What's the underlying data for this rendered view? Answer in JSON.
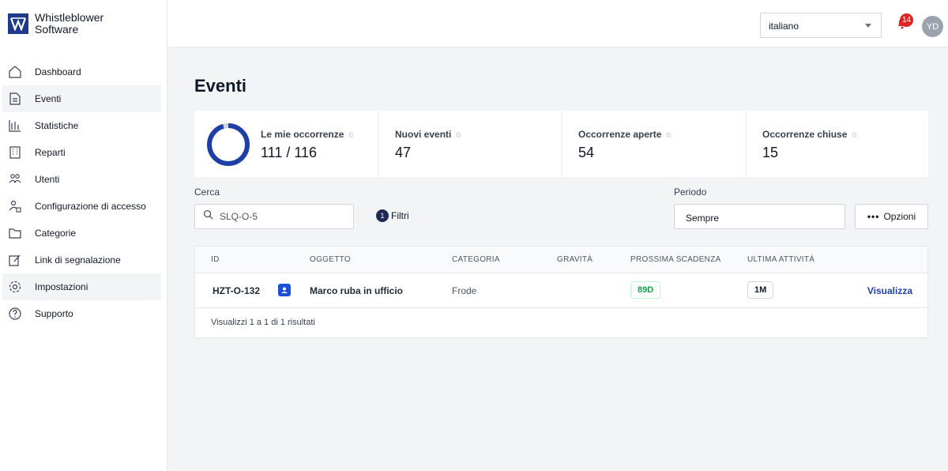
{
  "app": {
    "name_line1": "Whistleblower",
    "name_line2": "Software"
  },
  "sidebar": {
    "items": [
      {
        "label": "Dashboard",
        "icon": "home-icon"
      },
      {
        "label": "Eventi",
        "icon": "document-icon",
        "active": true
      },
      {
        "label": "Statistiche",
        "icon": "chart-icon"
      },
      {
        "label": "Reparti",
        "icon": "building-icon"
      },
      {
        "label": "Utenti",
        "icon": "users-icon"
      },
      {
        "label": "Configurazione di accesso",
        "icon": "user-lock-icon"
      },
      {
        "label": "Categorie",
        "icon": "folder-icon"
      },
      {
        "label": "Link di segnalazione",
        "icon": "edit-link-icon"
      },
      {
        "label": "Impostazioni",
        "icon": "gear-icon",
        "active": true
      },
      {
        "label": "Supporto",
        "icon": "help-icon"
      }
    ]
  },
  "header": {
    "language": "italiano",
    "notification_count": "14",
    "avatar_initials": "YD"
  },
  "page": {
    "title": "Eventi"
  },
  "stats": {
    "mine_label": "Le mie occorrenze",
    "mine_value": "111 / 116",
    "mine_ratio": 0.957,
    "new_label": "Nuovi eventi",
    "new_value": "47",
    "open_label": "Occorrenze aperte",
    "open_value": "54",
    "closed_label": "Occorrenze chiuse",
    "closed_value": "15"
  },
  "search": {
    "label": "Cerca",
    "value": "SLQ-O-5"
  },
  "filters": {
    "count": "1",
    "label": "Filtri"
  },
  "period": {
    "label": "Periodo",
    "value": "Sempre"
  },
  "options": {
    "label": "Opzioni"
  },
  "table": {
    "columns": [
      "ID",
      "OGGETTO",
      "CATEGORIA",
      "GRAVITÀ",
      "PROSSIMA SCADENZA",
      "ULTIMA ATTIVITÀ"
    ],
    "rows": [
      {
        "id": "HZT-O-132",
        "subject": "Marco ruba in ufficio",
        "category": "Frode",
        "severity": "",
        "deadline": "89D",
        "last_activity": "1M",
        "action": "Visualizza"
      }
    ],
    "footer": "Visualizzi 1 a 1 di 1 risultati"
  },
  "colors": {
    "brand": "#1e3a8a",
    "accent_link": "#1e40af",
    "deadline_green": "#16a34a",
    "badge_red": "#dc2626"
  }
}
